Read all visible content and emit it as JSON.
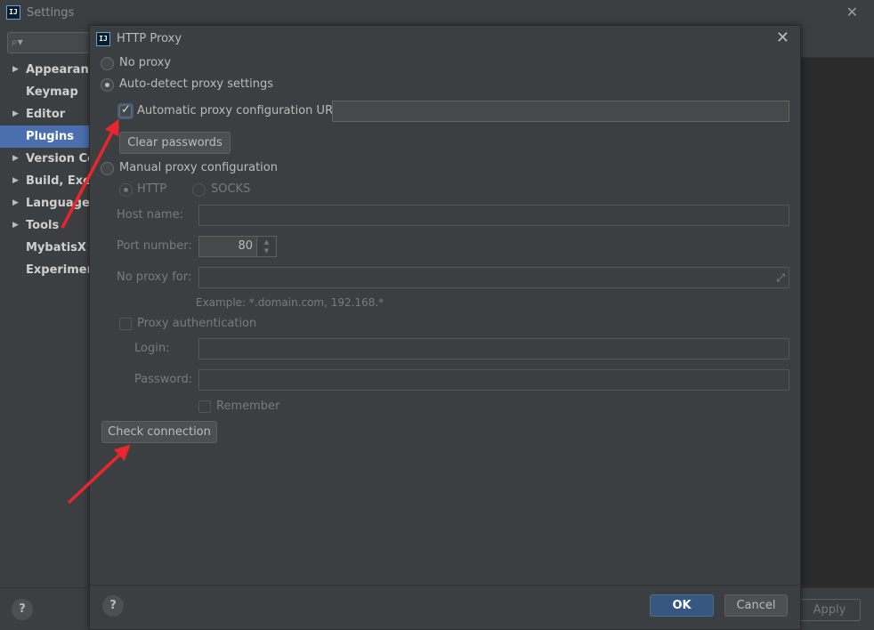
{
  "settings": {
    "title": "Settings",
    "close_icon": "✕",
    "search_icon": "⌕▾",
    "sidebar": [
      {
        "label": "Appearance",
        "has_arrow": true
      },
      {
        "label": "Keymap",
        "has_arrow": false
      },
      {
        "label": "Editor",
        "has_arrow": true
      },
      {
        "label": "Plugins",
        "has_arrow": false,
        "active": true
      },
      {
        "label": "Version Control",
        "has_arrow": true
      },
      {
        "label": "Build, Execution",
        "has_arrow": true
      },
      {
        "label": "Languages",
        "has_arrow": true
      },
      {
        "label": "Tools",
        "has_arrow": true
      },
      {
        "label": "MybatisX",
        "has_arrow": false
      },
      {
        "label": "Experimental",
        "has_arrow": false
      }
    ],
    "help_label": "?",
    "apply_label": "Apply"
  },
  "dialog": {
    "icon_text": "IJ",
    "title": "HTTP Proxy",
    "close_icon": "✕",
    "no_proxy_label": "No proxy",
    "auto_detect_label": "Auto-detect proxy settings",
    "auto_config_url_label": "Automatic proxy configuration URL:",
    "auto_config_url_value": "",
    "clear_passwords_label": "Clear passwords",
    "manual_label": "Manual proxy configuration",
    "http_label": "HTTP",
    "socks_label": "SOCKS",
    "host_label": "Host name:",
    "host_value": "",
    "port_label": "Port number:",
    "port_value": "80",
    "no_proxy_for_label": "No proxy for:",
    "no_proxy_for_value": "",
    "example_text": "Example: *.domain.com, 192.168.*",
    "proxy_auth_label": "Proxy authentication",
    "login_label": "Login:",
    "login_value": "",
    "password_label": "Password:",
    "password_value": "",
    "remember_label": "Remember",
    "check_connection_label": "Check connection",
    "help_label": "?",
    "ok_label": "OK",
    "cancel_label": "Cancel"
  },
  "colors": {
    "background": "#3c3f41",
    "accent": "#4b6eaf",
    "ok_button": "#365880",
    "annotation_arrow": "#e8262b"
  }
}
